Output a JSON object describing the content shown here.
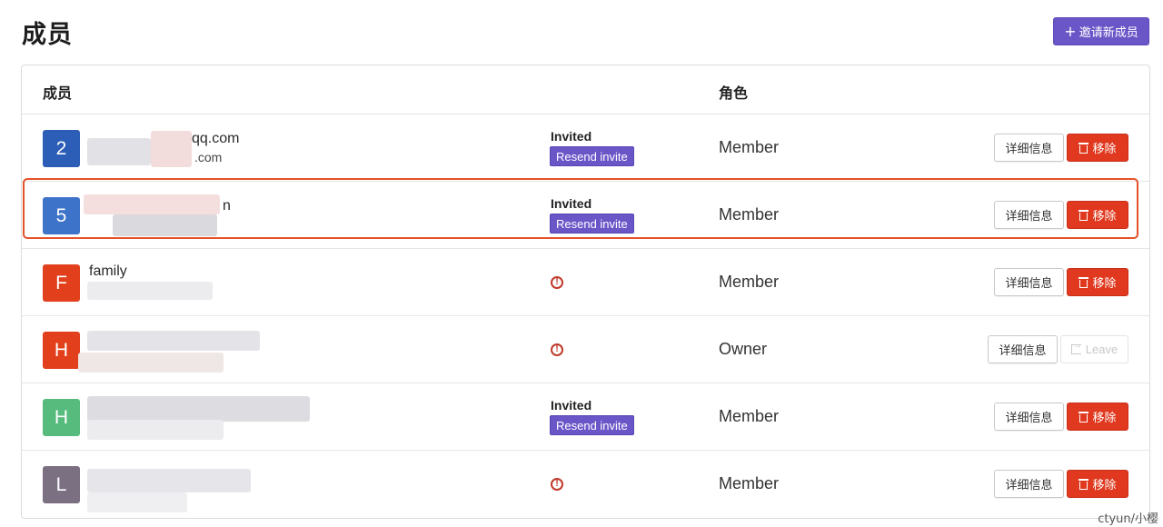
{
  "header": {
    "title": "成员",
    "invite_plus": "+",
    "invite_label": "邀请新成员"
  },
  "table": {
    "col_member": "成员",
    "col_role": "角色",
    "rows": [
      {
        "avatar_letter": "2",
        "avatar_color": "#2c5db7",
        "name": "qq.com",
        "sub": ".com",
        "invited": "Invited",
        "resend": "Resend invite",
        "status_icon": "",
        "role": "Member",
        "details": "详细信息",
        "remove": "移除"
      },
      {
        "avatar_letter": "5",
        "avatar_color": "#3d73c9",
        "name": "n",
        "sub": "",
        "invited": "Invited",
        "resend": "Resend invite",
        "status_icon": "",
        "role": "Member",
        "details": "详细信息",
        "remove": "移除"
      },
      {
        "avatar_letter": "F",
        "avatar_color": "#e2401c",
        "name": "family",
        "sub": "",
        "invited": "",
        "resend": "",
        "status_icon": "!",
        "role": "Member",
        "details": "详细信息",
        "remove": "移除"
      },
      {
        "avatar_letter": "H",
        "avatar_color": "#e2401c",
        "name": "",
        "sub": "",
        "invited": "",
        "resend": "",
        "status_icon": "!",
        "role": "Owner",
        "details": "详细信息",
        "leave": "Leave"
      },
      {
        "avatar_letter": "H",
        "avatar_color": "#57bb7e",
        "name": "",
        "sub": "",
        "invited": "Invited",
        "resend": "Resend invite",
        "status_icon": "",
        "role": "Member",
        "details": "详细信息",
        "remove": "移除"
      },
      {
        "avatar_letter": "L",
        "avatar_color": "#7b6f82",
        "name": "",
        "sub": "",
        "invited": "",
        "resend": "",
        "status_icon": "!",
        "role": "Member",
        "details": "详细信息",
        "remove": "移除"
      }
    ]
  },
  "watermark": "ctyun/小樱"
}
